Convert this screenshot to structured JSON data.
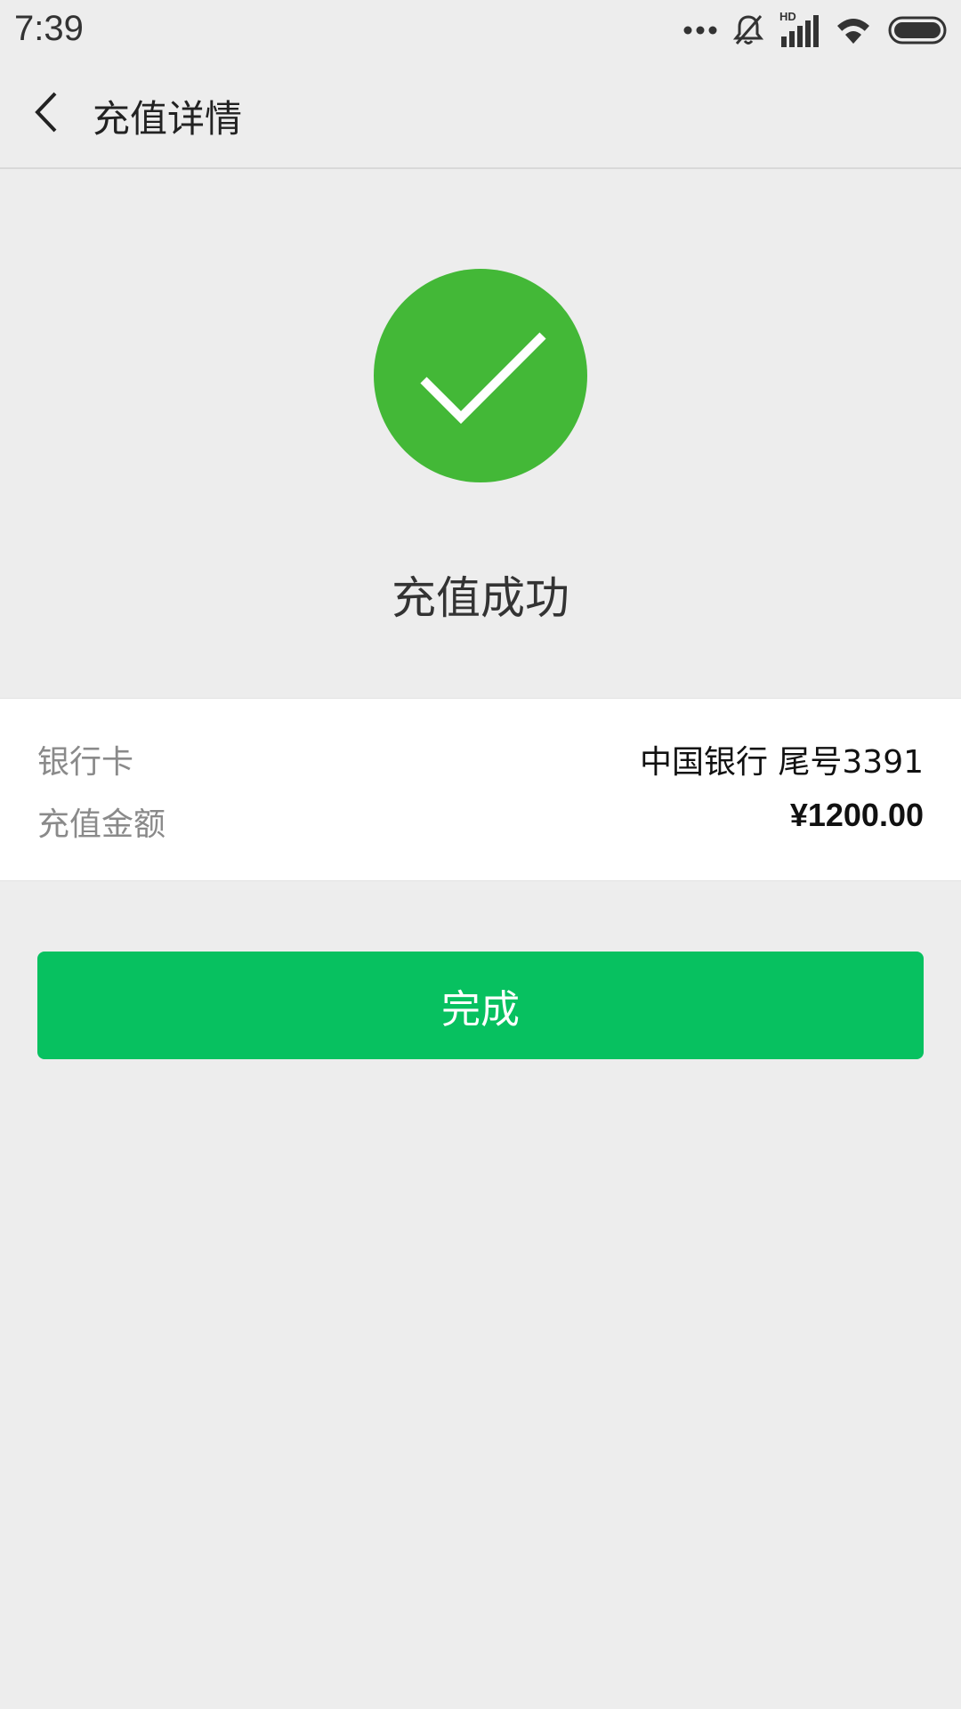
{
  "status_bar": {
    "time": "7:39",
    "icons": [
      "more-dots-icon",
      "bell-off-icon",
      "hd-signal-icon",
      "wifi-icon",
      "battery-icon"
    ],
    "hd_label": "HD"
  },
  "header": {
    "back_icon": "chevron-left-icon",
    "title": "充值详情"
  },
  "result": {
    "icon": "check-circle-icon",
    "icon_color": "#43b837",
    "message": "充值成功"
  },
  "details": {
    "bank_label": "银行卡",
    "bank_value": "中国银行 尾号3391",
    "amount_label": "充值金额",
    "amount_value": "¥1200.00"
  },
  "actions": {
    "done_label": "完成",
    "done_color": "#07c160"
  }
}
